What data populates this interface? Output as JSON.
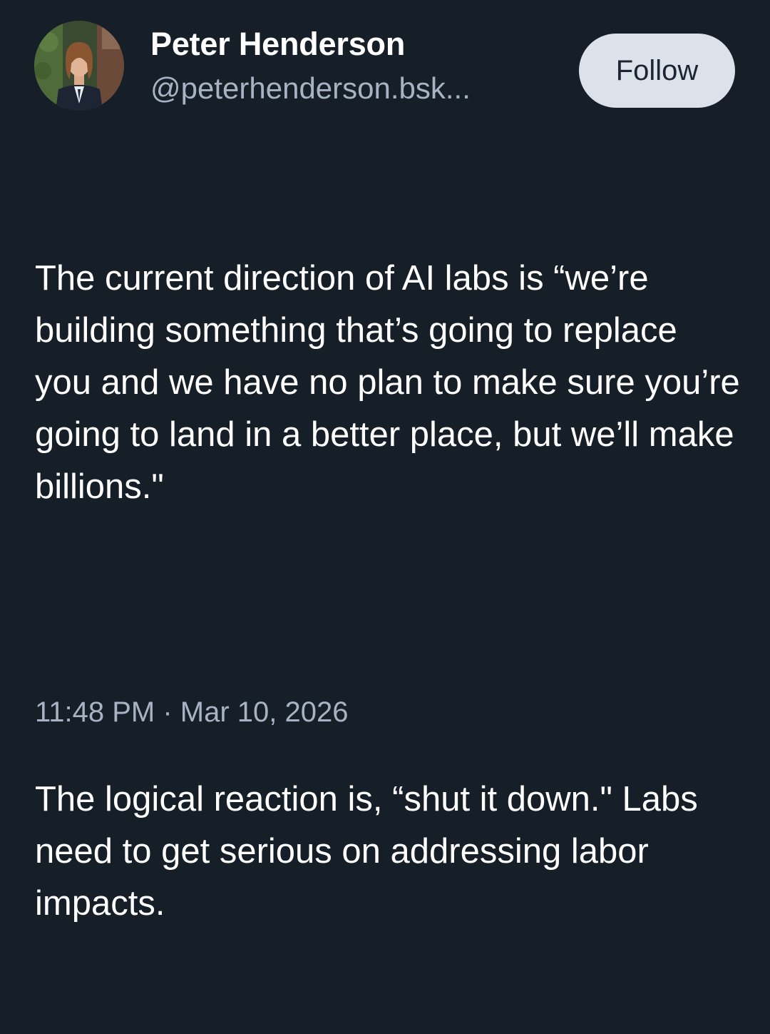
{
  "author": {
    "display_name": "Peter Henderson",
    "handle": "@peterhenderson.bsk...",
    "avatar": "profile-photo"
  },
  "follow_button": {
    "label": "Follow"
  },
  "post": {
    "paragraphs": [
      "The current direction of AI labs is “we’re building something that’s going to replace you and we have no plan to make sure you’re going to land in a better place, but we’ll make billions.\"",
      "The logical reaction is, “shut it down.\" Labs need to get serious on addressing labor impacts."
    ],
    "timestamp": "11:48 PM · Mar 10, 2026"
  },
  "colors": {
    "background": "#161e27",
    "text": "#ffffff",
    "secondary_text": "#a7b3c3",
    "button_background": "#dce2ea",
    "button_text": "#1b2533"
  }
}
